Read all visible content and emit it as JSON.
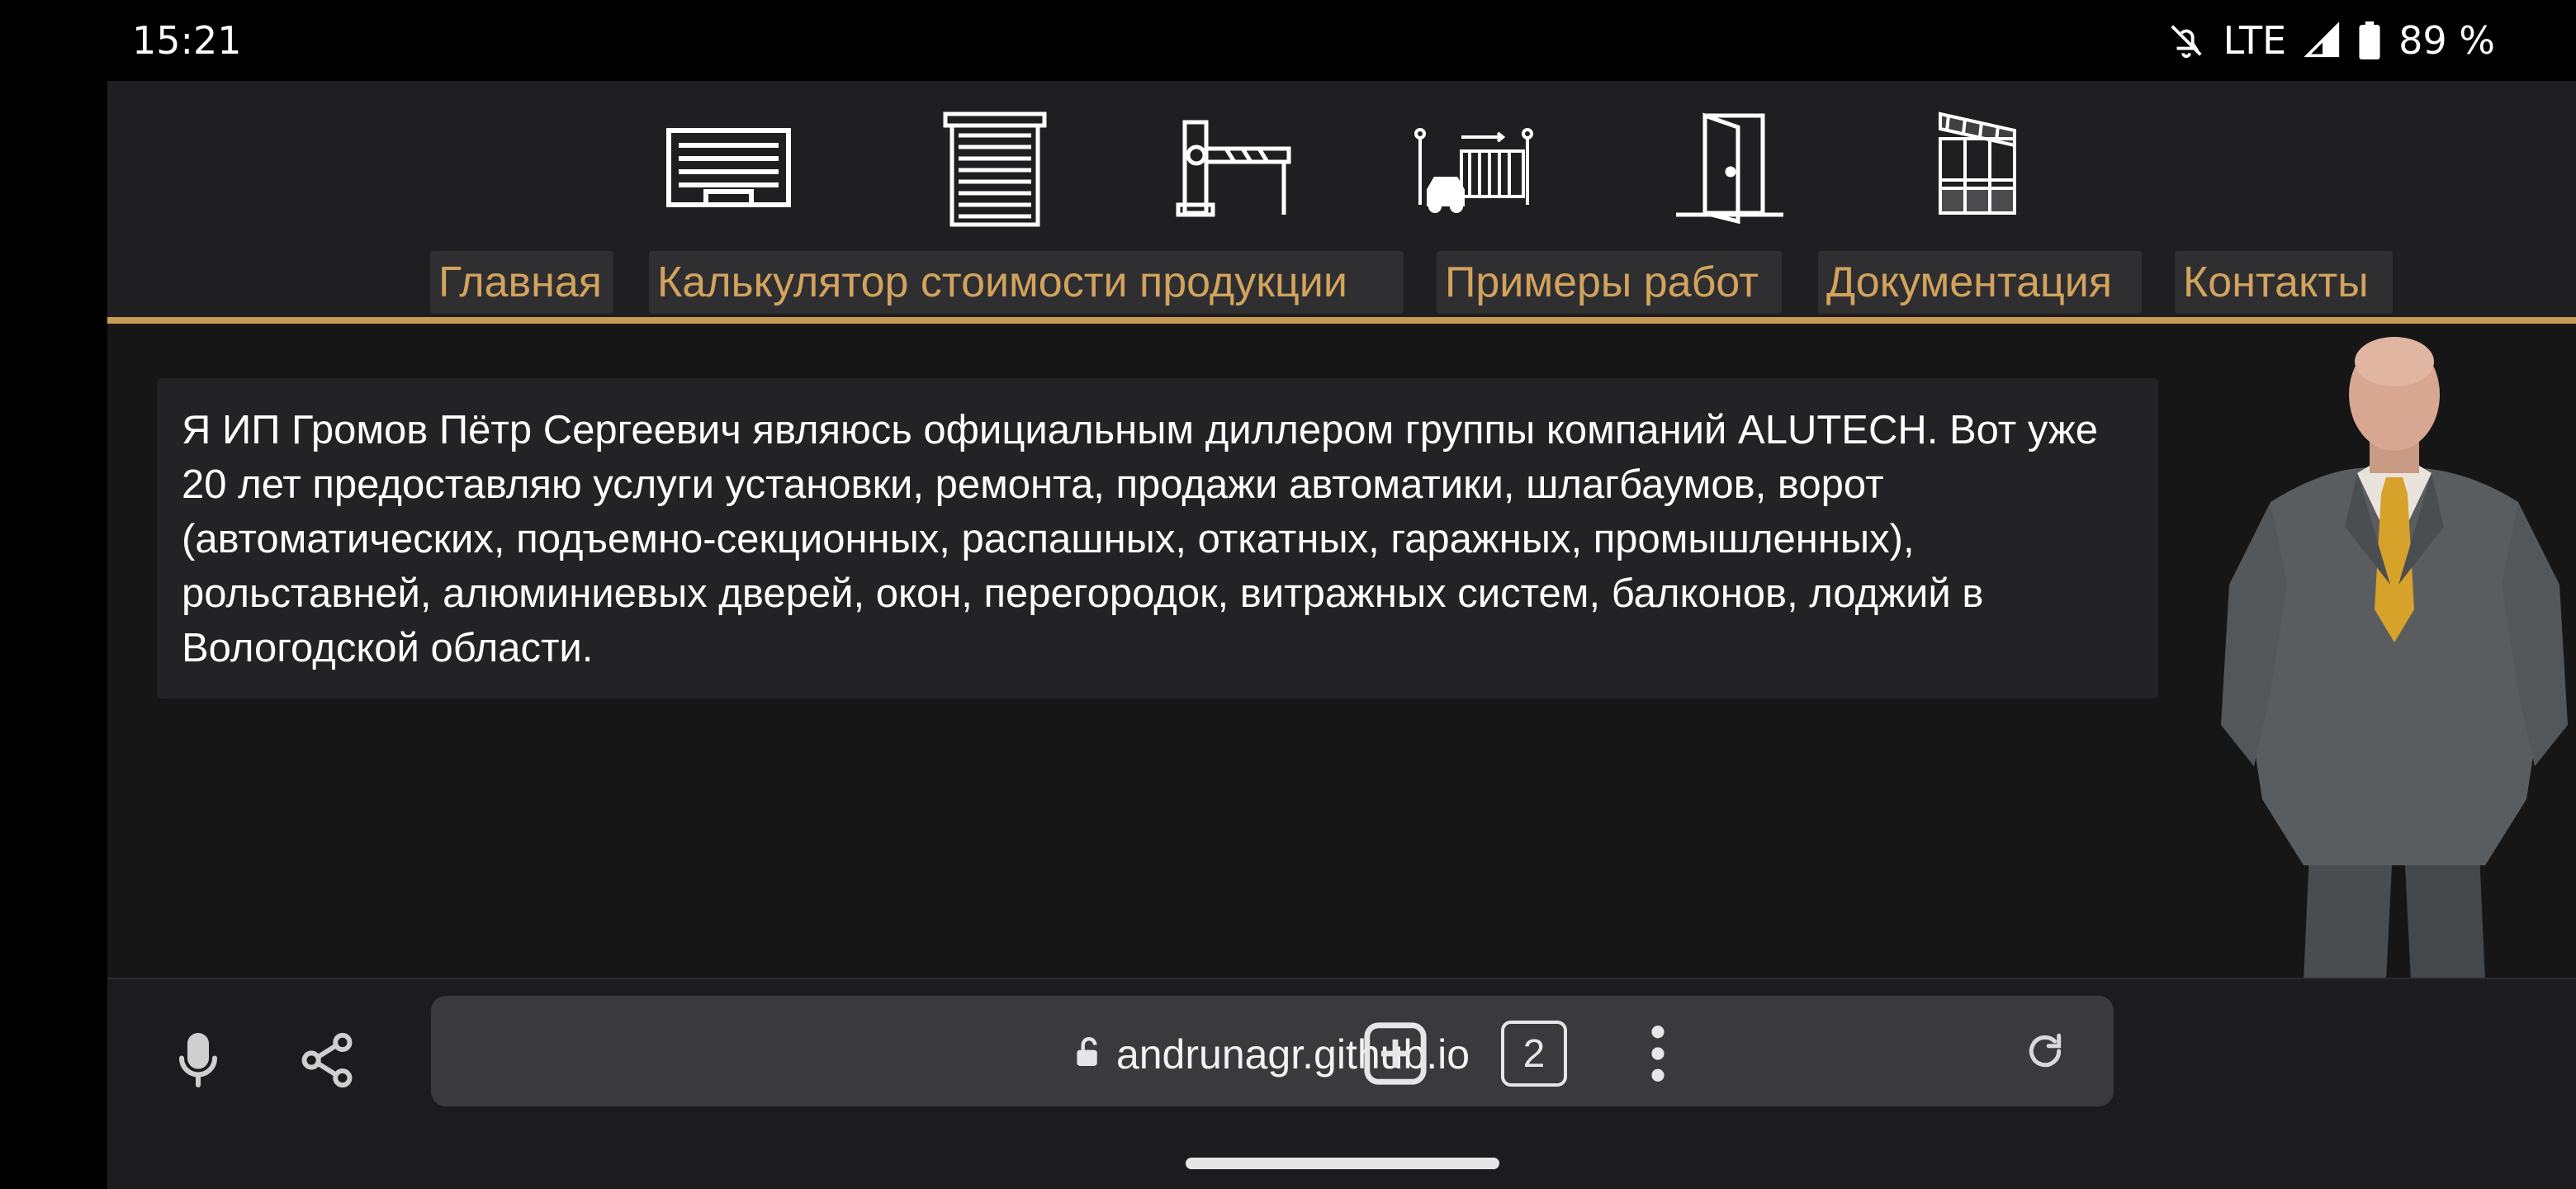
{
  "status_bar": {
    "time": "15:21",
    "network": "LTE",
    "battery": "89 %",
    "icons": [
      "mute-icon",
      "signal-icon",
      "battery-icon"
    ]
  },
  "site": {
    "nav_icons": [
      "garage-door-icon",
      "roller-shutter-icon",
      "barrier-icon",
      "sliding-gate-icon",
      "door-icon",
      "balcony-icon"
    ],
    "nav": [
      {
        "label": "Главная"
      },
      {
        "label": "Калькулятор стоимости продукции"
      },
      {
        "label": "Примеры работ"
      },
      {
        "label": "Документация"
      },
      {
        "label": "Контакты"
      }
    ],
    "about": "Я ИП Громов Пётр Сергеевич являюсь официальным диллером группы компаний ALUTECH. Вот уже 20 лет предоставляю услуги установки, ремонта, продажи автоматики, шлагбаумов, ворот (автоматических, подъемно-секционных, распашных, откатных, гаражных, промышленных), рольставней, алюминиевых дверей, окон, перегородок, витражных систем, балконов, лоджий в Вологодской области.",
    "colors": {
      "accent": "#c89b57",
      "background": "#161617",
      "nav_bg": "#2f2f31"
    }
  },
  "browser": {
    "url": "andrunagr.github.io",
    "tab_count": "2",
    "icons": [
      "mic-icon",
      "share-icon",
      "lock-icon",
      "reload-icon",
      "new-tab-icon",
      "tabs-icon",
      "more-icon"
    ]
  }
}
